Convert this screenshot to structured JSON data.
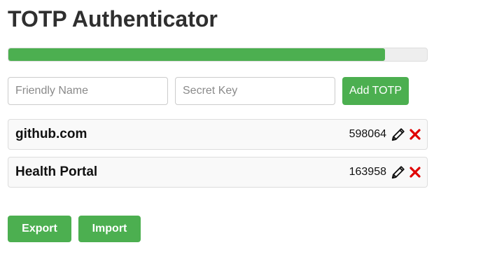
{
  "app": {
    "title": "TOTP Authenticator"
  },
  "progress": {
    "fraction": 0.9,
    "color": "#4caf50",
    "track_color": "#eeeeee"
  },
  "form": {
    "name_placeholder": "Friendly Name",
    "name_value": "",
    "secret_placeholder": "Secret Key",
    "secret_value": "",
    "add_label": "Add TOTP"
  },
  "entries": [
    {
      "name": "github.com",
      "code": "598064",
      "edit_icon": "pencil-icon",
      "delete_icon": "close-icon"
    },
    {
      "name": "Health Portal",
      "code": "163958",
      "edit_icon": "pencil-icon",
      "delete_icon": "close-icon"
    }
  ],
  "footer": {
    "export_label": "Export",
    "import_label": "Import"
  },
  "colors": {
    "accent": "#4caf50",
    "delete": "#e00000"
  }
}
